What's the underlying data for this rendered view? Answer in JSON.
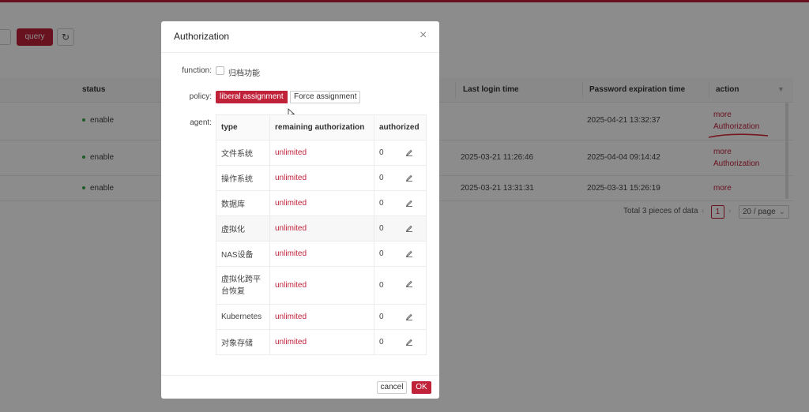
{
  "toolbar": {
    "query_label": "query",
    "refresh_icon": "refresh-icon"
  },
  "background_table": {
    "columns": [
      "status",
      "Last login time",
      "Password expiration time",
      "action"
    ],
    "rows": [
      {
        "status": "enable",
        "last_login": "",
        "pwd_expire": "2025-04-21 13:32:37",
        "actions": [
          "more",
          "Authorization"
        ]
      },
      {
        "status": "enable",
        "last_login": "2025-03-21 11:26:46",
        "pwd_expire": "2025-04-04 09:14:42",
        "actions": [
          "more",
          "Authorization"
        ]
      },
      {
        "status": "enable",
        "last_login": "2025-03-21 13:31:31",
        "pwd_expire": "2025-03-31 15:26:19",
        "actions": [
          "more"
        ]
      }
    ],
    "pagination": {
      "total": "Total 3 pieces of data",
      "page": "1",
      "page_size": "20 / page"
    }
  },
  "modal": {
    "title": "Authorization",
    "function_label": "function:",
    "function_checkbox_label": "归档功能",
    "policy_label": "policy:",
    "policy_options": [
      "liberal assignment",
      "Force assignment"
    ],
    "policy_selected": "liberal assignment",
    "agent_label": "agent:",
    "agent_table": {
      "headers": [
        "type",
        "remaining authorization",
        "authorized"
      ],
      "rows": [
        {
          "type": "文件系统",
          "remaining": "unlimited",
          "authorized": "0"
        },
        {
          "type": "操作系统",
          "remaining": "unlimited",
          "authorized": "0"
        },
        {
          "type": "数据库",
          "remaining": "unlimited",
          "authorized": "0"
        },
        {
          "type": "虚拟化",
          "remaining": "unlimited",
          "authorized": "0"
        },
        {
          "type": "NAS设备",
          "remaining": "unlimited",
          "authorized": "0"
        },
        {
          "type": "虚拟化跨平台恢复",
          "remaining": "unlimited",
          "authorized": "0"
        },
        {
          "type": "Kubernetes",
          "remaining": "unlimited",
          "authorized": "0"
        },
        {
          "type": "对象存储",
          "remaining": "unlimited",
          "authorized": "0"
        }
      ]
    },
    "cancel_label": "cancel",
    "ok_label": "OK"
  },
  "colors": {
    "accent": "#c0223a",
    "status_enable": "#3aa44a",
    "overlay": "rgba(0,0,0,0.45)"
  }
}
